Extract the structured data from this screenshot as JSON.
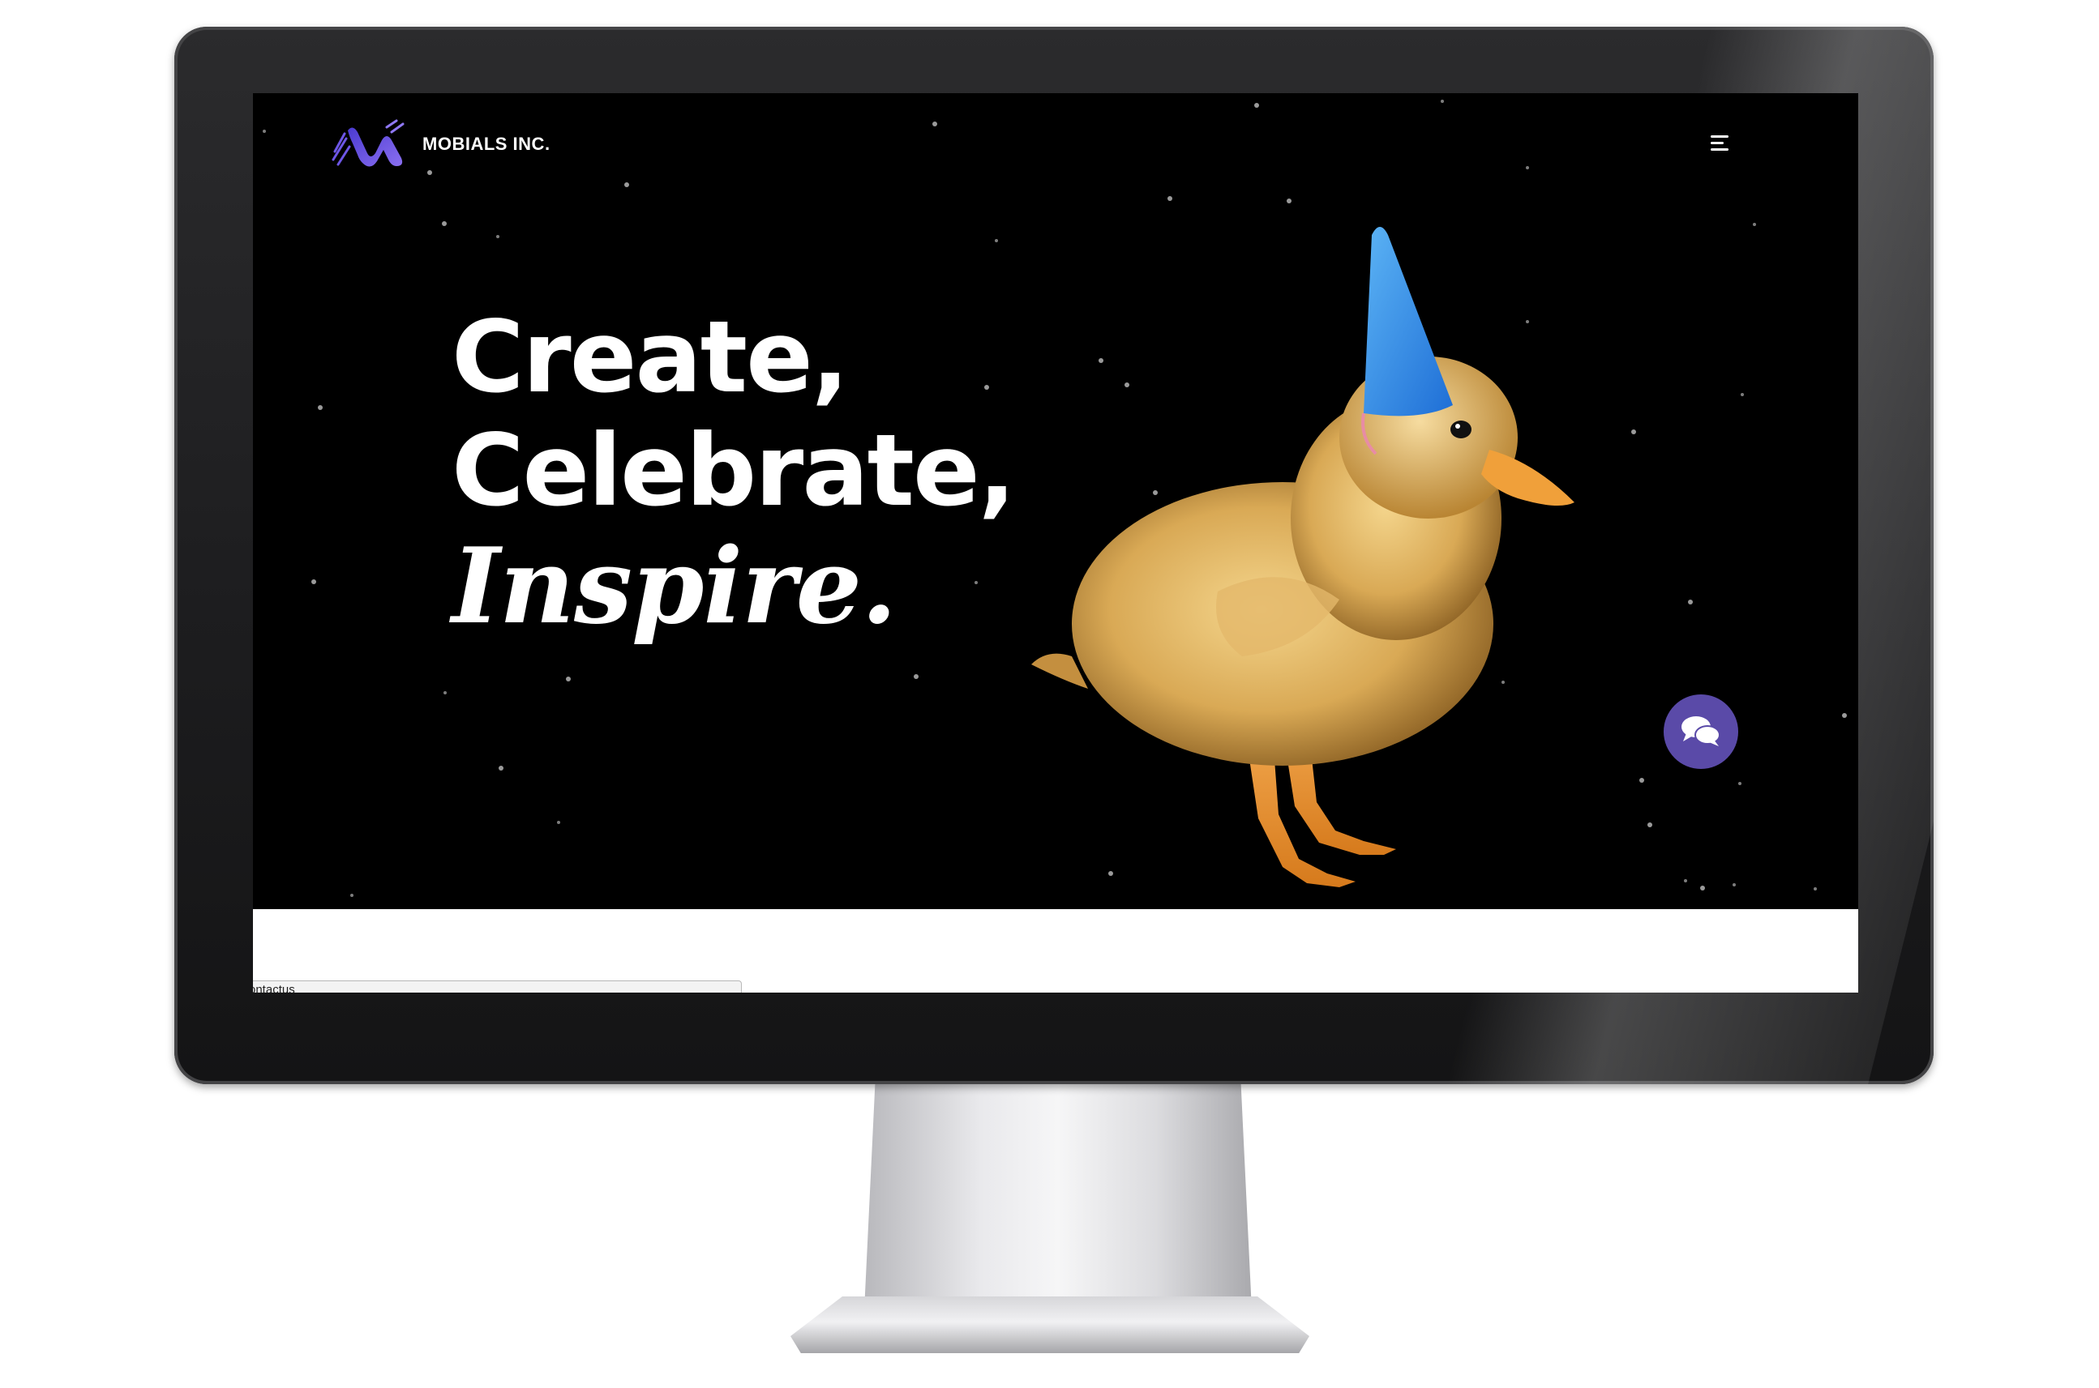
{
  "site": {
    "brand_name": "MOBIALS INC.",
    "accent_color": "#5a4aa8",
    "logo_icon": "wave-w-logo-icon",
    "menu_icon": "hamburger-menu-icon",
    "chat_icon": "chat-bubbles-icon"
  },
  "hero": {
    "line1": "Create,",
    "line2": "Celebrate,",
    "line3": "Inspire.",
    "image": "duckling-party-hat-image"
  },
  "footer_bar": {
    "contact_tab_label": "ontactus"
  }
}
